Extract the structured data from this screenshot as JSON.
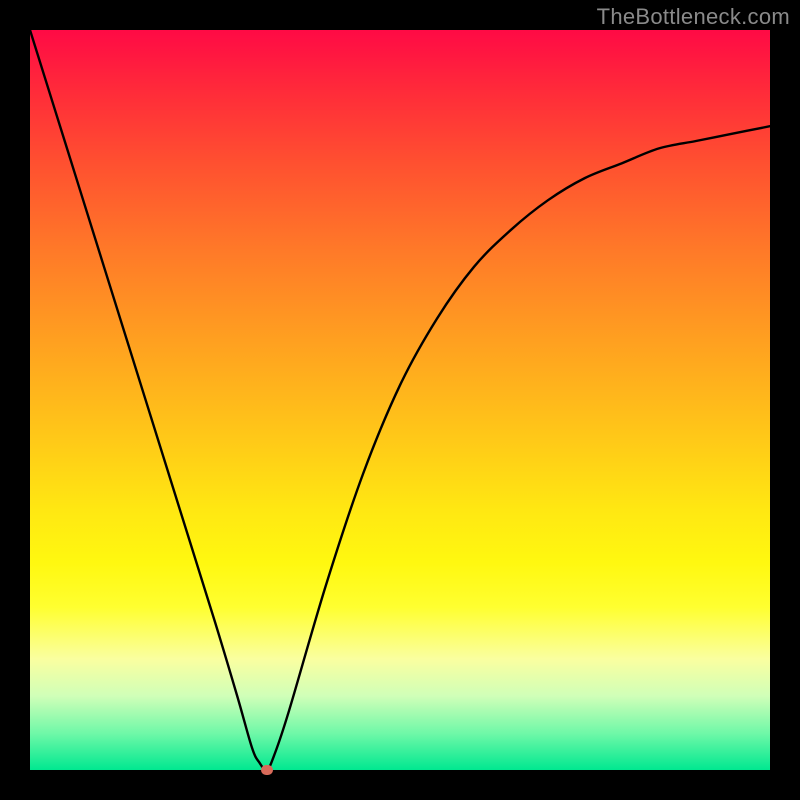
{
  "watermark": "TheBottleneck.com",
  "chart_data": {
    "type": "line",
    "title": "",
    "xlabel": "",
    "ylabel": "",
    "xlim": [
      0,
      100
    ],
    "ylim": [
      0,
      100
    ],
    "series": [
      {
        "name": "bottleneck-curve",
        "x": [
          0,
          5,
          10,
          15,
          20,
          25,
          28,
          30,
          31,
          32,
          33,
          35,
          40,
          45,
          50,
          55,
          60,
          65,
          70,
          75,
          80,
          85,
          90,
          95,
          100
        ],
        "y": [
          100,
          84,
          68,
          52,
          36,
          20,
          10,
          3,
          1,
          0,
          2,
          8,
          25,
          40,
          52,
          61,
          68,
          73,
          77,
          80,
          82,
          84,
          85,
          86,
          87
        ]
      }
    ],
    "marker": {
      "x": 32,
      "y": 0,
      "color": "#d86a5a"
    },
    "background_gradient": {
      "top": "#ff0a45",
      "mid": "#ffe812",
      "bottom": "#00e890"
    }
  }
}
